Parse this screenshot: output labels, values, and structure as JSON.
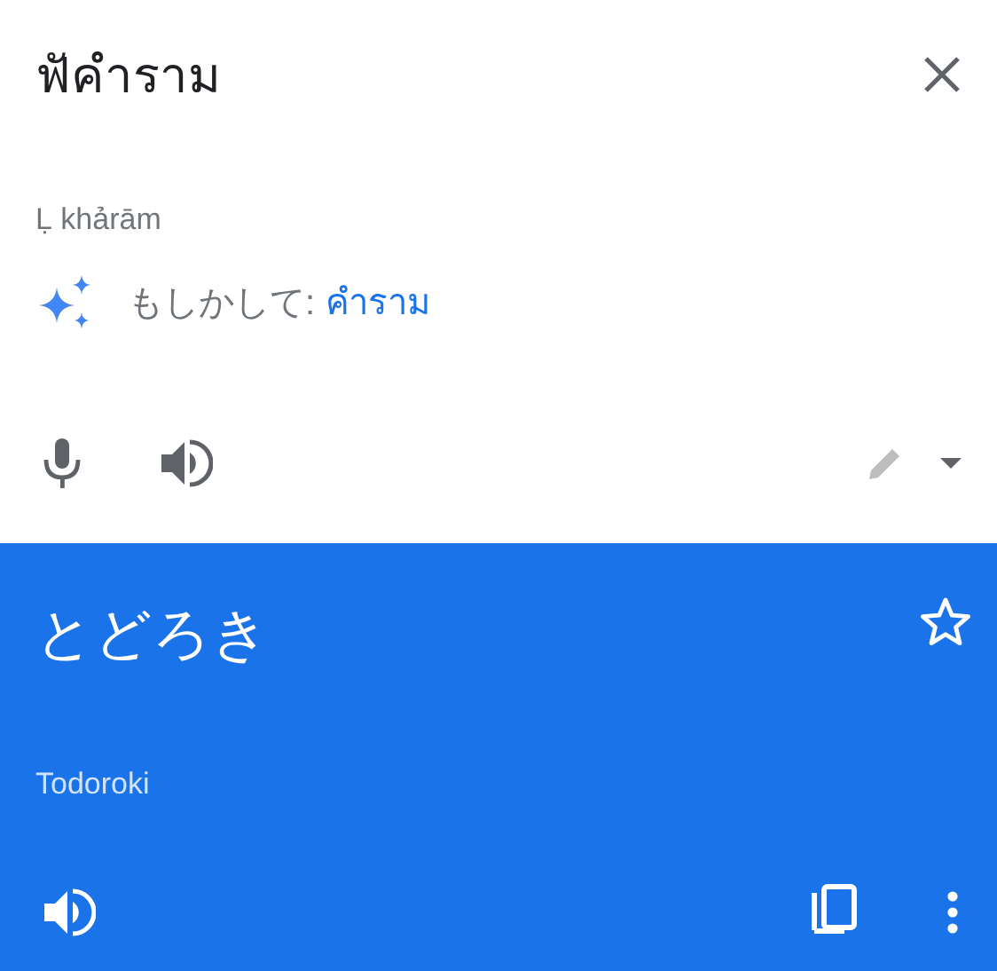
{
  "source": {
    "text": "ฟัคำราม",
    "romanization": "Ḷ khảrām"
  },
  "suggestion": {
    "label": "もしかして:",
    "text": "คำราม"
  },
  "source_tools": {
    "edit_disabled": true
  },
  "translation": {
    "text": "とどろき",
    "romanization": "Todoroki",
    "starred": false
  }
}
